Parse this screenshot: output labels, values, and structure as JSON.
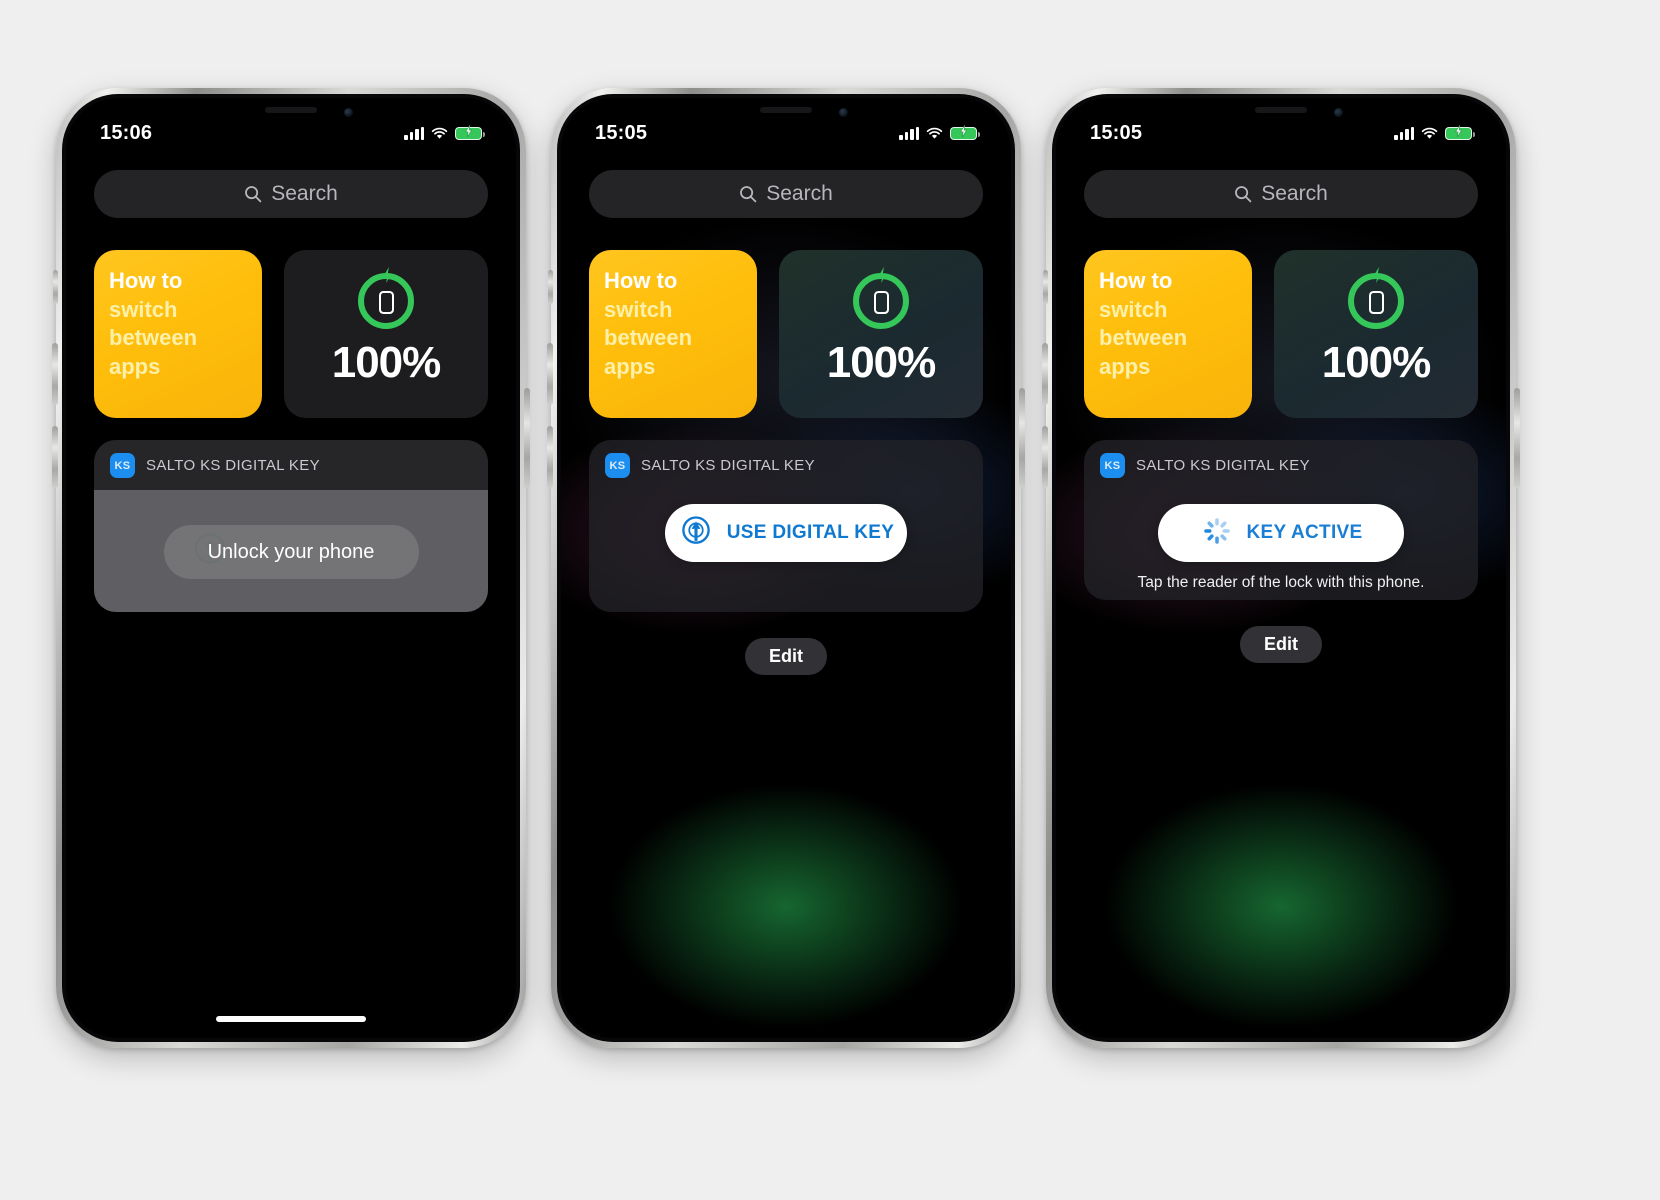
{
  "phones": [
    {
      "id": "phone-locked",
      "status": {
        "time": "15:06",
        "cellular": "signal-bars-icon",
        "wifi": "wifi-icon",
        "battery": "battery-charging-icon"
      },
      "search": {
        "placeholder": "Search",
        "icon": "search-icon"
      },
      "tip_widget": {
        "line1": "How to",
        "line2": "switch",
        "line3": "between",
        "line4": "apps"
      },
      "battery_widget": {
        "percent": "100%",
        "icon": "phone-charging-ring-icon"
      },
      "salto": {
        "app_badge": "KS",
        "title": "SALTO KS DIGITAL KEY",
        "state": "locked",
        "action_label": "Unlock your phone",
        "hint": ""
      },
      "edit_label": "",
      "home_indicator": true
    },
    {
      "id": "phone-use-key",
      "status": {
        "time": "15:05",
        "cellular": "signal-bars-icon",
        "wifi": "wifi-icon",
        "battery": "battery-charging-icon"
      },
      "search": {
        "placeholder": "Search",
        "icon": "search-icon"
      },
      "tip_widget": {
        "line1": "How to",
        "line2": "switch",
        "line3": "between",
        "line4": "apps"
      },
      "battery_widget": {
        "percent": "100%",
        "icon": "phone-charging-ring-icon"
      },
      "salto": {
        "app_badge": "KS",
        "title": "SALTO KS DIGITAL KEY",
        "state": "ready",
        "action_label": "USE DIGITAL KEY",
        "action_icon": "nfc-key-icon",
        "hint": ""
      },
      "edit_label": "Edit",
      "home_indicator": false
    },
    {
      "id": "phone-key-active",
      "status": {
        "time": "15:05",
        "cellular": "signal-bars-icon",
        "wifi": "wifi-icon",
        "battery": "battery-charging-icon"
      },
      "search": {
        "placeholder": "Search",
        "icon": "search-icon"
      },
      "tip_widget": {
        "line1": "How to",
        "line2": "switch",
        "line3": "between",
        "line4": "apps"
      },
      "battery_widget": {
        "percent": "100%",
        "icon": "phone-charging-ring-icon"
      },
      "salto": {
        "app_badge": "KS",
        "title": "SALTO KS DIGITAL KEY",
        "state": "active",
        "action_label": "KEY ACTIVE",
        "action_icon": "spinner-icon",
        "hint": "Tap the reader of the lock with this phone."
      },
      "edit_label": "Edit",
      "home_indicator": false
    }
  ],
  "colors": {
    "tip_yellow": "#ffbe0b",
    "tip_text_secondary": "#fdf0a8",
    "battery_green": "#35c759",
    "salto_blue": "#1c8ef0",
    "action_blue": "#0f79d0",
    "page_background": "#efefef"
  }
}
